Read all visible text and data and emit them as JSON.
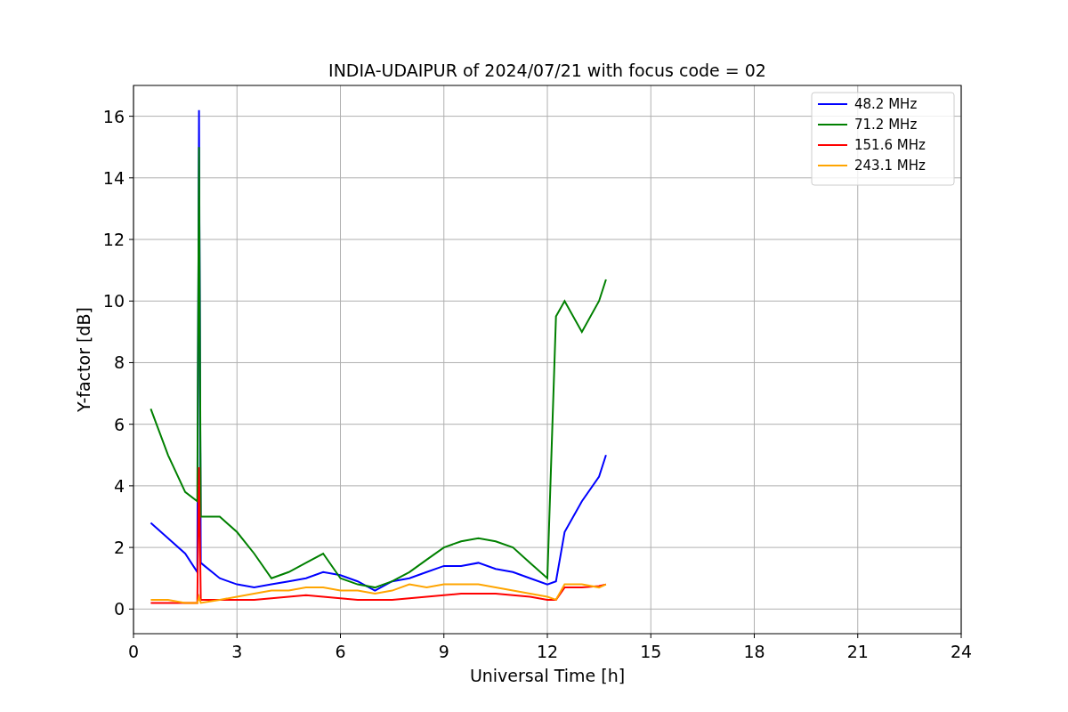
{
  "chart_data": {
    "type": "line",
    "title": "INDIA-UDAIPUR of 2024/07/21 with focus code = 02",
    "xlabel": "Universal Time [h]",
    "ylabel": "Y-factor [dB]",
    "x": [
      0.5,
      1,
      1.5,
      1.85,
      1.9,
      1.95,
      2.5,
      3,
      3.5,
      4,
      4.5,
      5,
      5.5,
      6,
      6.5,
      7,
      7.5,
      8,
      8.5,
      9,
      9.5,
      10,
      10.5,
      11,
      11.5,
      12,
      12.25,
      12.5,
      13,
      13.5,
      13.7
    ],
    "series": [
      {
        "name": "48.2 MHz",
        "color": "#0000ff",
        "values": [
          2.8,
          2.3,
          1.8,
          1.2,
          16.2,
          1.5,
          1.0,
          0.8,
          0.7,
          0.8,
          0.9,
          1.0,
          1.2,
          1.1,
          0.9,
          0.6,
          0.9,
          1.0,
          1.2,
          1.4,
          1.4,
          1.5,
          1.3,
          1.2,
          1.0,
          0.8,
          0.9,
          2.5,
          3.5,
          4.3,
          5.0
        ]
      },
      {
        "name": "71.2 MHz",
        "color": "#008000",
        "values": [
          6.5,
          5.0,
          3.8,
          3.5,
          15.0,
          3.0,
          3.0,
          2.5,
          1.8,
          1.0,
          1.2,
          1.5,
          1.8,
          1.0,
          0.8,
          0.7,
          0.9,
          1.2,
          1.6,
          2.0,
          2.2,
          2.3,
          2.2,
          2.0,
          1.5,
          1.0,
          9.5,
          10.0,
          9.0,
          10.0,
          10.7
        ]
      },
      {
        "name": "151.6 MHz",
        "color": "#ff0000",
        "values": [
          0.2,
          0.2,
          0.2,
          0.2,
          4.6,
          0.3,
          0.3,
          0.3,
          0.3,
          0.35,
          0.4,
          0.45,
          0.4,
          0.35,
          0.3,
          0.3,
          0.3,
          0.35,
          0.4,
          0.45,
          0.5,
          0.5,
          0.5,
          0.45,
          0.4,
          0.3,
          0.3,
          0.7,
          0.7,
          0.75,
          0.8
        ]
      },
      {
        "name": "243.1 MHz",
        "color": "#ffa500",
        "values": [
          0.3,
          0.3,
          0.2,
          0.2,
          0.4,
          0.2,
          0.3,
          0.4,
          0.5,
          0.6,
          0.6,
          0.7,
          0.7,
          0.6,
          0.6,
          0.5,
          0.6,
          0.8,
          0.7,
          0.8,
          0.8,
          0.8,
          0.7,
          0.6,
          0.5,
          0.4,
          0.3,
          0.8,
          0.8,
          0.7,
          0.8
        ]
      }
    ],
    "xlim": [
      0,
      24
    ],
    "ylim": [
      -0.8,
      17
    ],
    "xticks": [
      0,
      3,
      6,
      9,
      12,
      15,
      18,
      21,
      24
    ],
    "yticks": [
      0,
      2,
      4,
      6,
      8,
      10,
      12,
      14,
      16
    ],
    "grid": true,
    "legend": true
  }
}
